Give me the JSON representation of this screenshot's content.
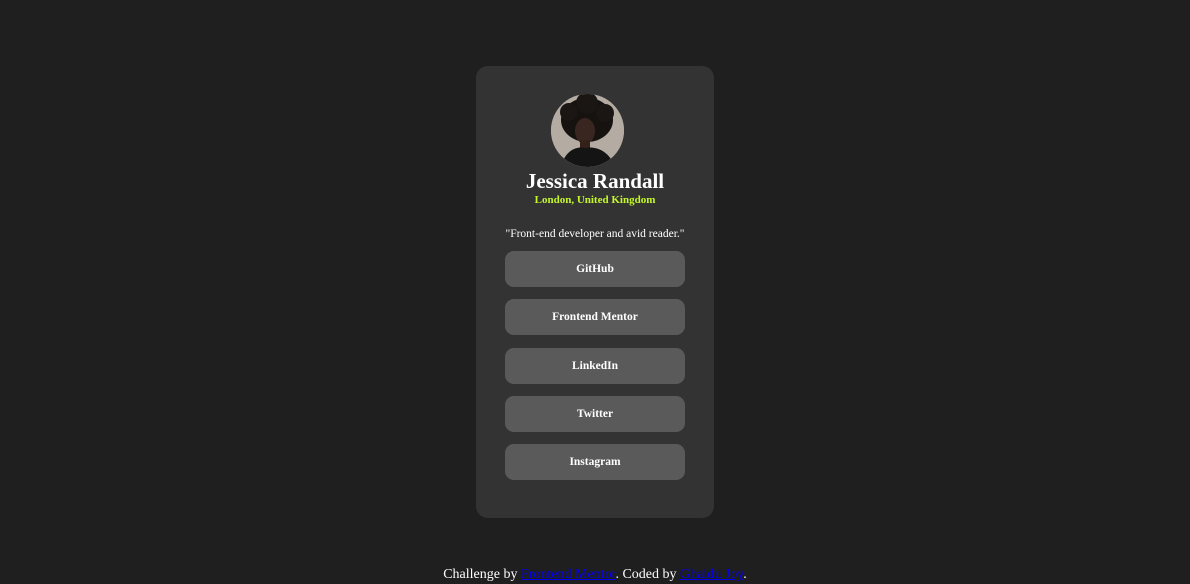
{
  "profile": {
    "name": "Jessica Randall",
    "location": "London, United Kingdom",
    "bio": "\"Front-end developer and avid reader.\""
  },
  "links": [
    {
      "label": "GitHub"
    },
    {
      "label": "Frontend Mentor"
    },
    {
      "label": "LinkedIn"
    },
    {
      "label": "Twitter"
    },
    {
      "label": "Instagram"
    }
  ],
  "footer": {
    "prefix": "Challenge by ",
    "challenge_link": "Frontend Mentor",
    "middle": ". Coded by ",
    "author_link": "Ghaidu Joy",
    "suffix": "."
  },
  "colors": {
    "page_background": "#1f1f1f",
    "card_background": "#333333",
    "button_background": "#5b5a5a",
    "accent": "#c4f82a",
    "link": "#0000ee"
  }
}
